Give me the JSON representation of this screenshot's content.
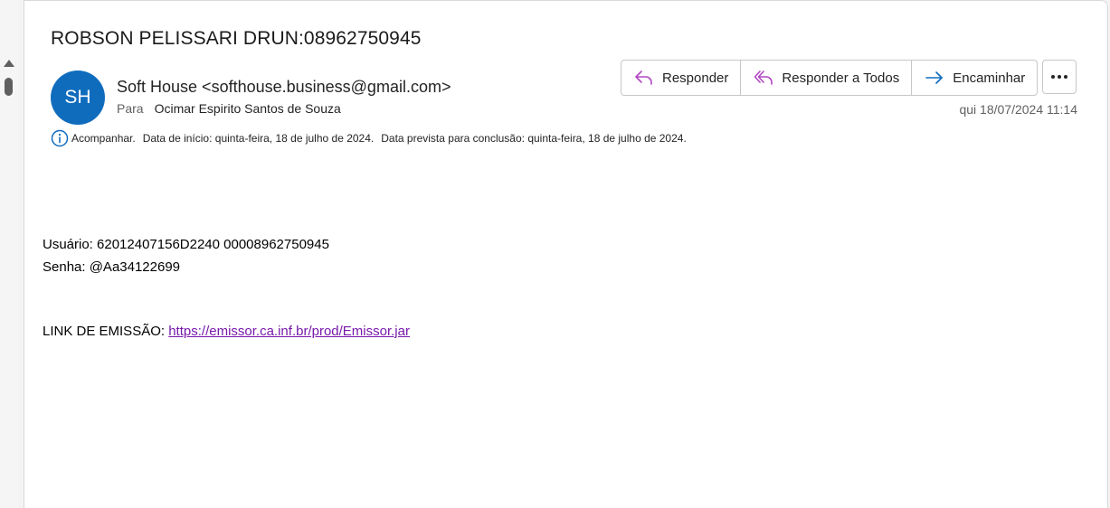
{
  "email": {
    "subject": "ROBSON PELISSARI DRUN:08962750945",
    "avatar_initials": "SH",
    "avatar_color": "#0f6cbd",
    "sender": "Soft House <softhouse.business@gmail.com>",
    "to_label": "Para",
    "to_name": "Ocimar Espirito Santos de Souza",
    "date": "qui 18/07/2024 11:14",
    "followup": {
      "icon": "info-icon",
      "flag": "Acompanhar.",
      "start": "Data de início: quinta-feira, 18 de julho de 2024.",
      "due": "Data prevista para conclusão: quinta-feira, 18 de julho de 2024."
    },
    "body": {
      "usuario_line": "Usuário: 62012407156D2240 00008962750945",
      "senha_line": "Senha: @Aa34122699",
      "link_label": "LINK DE EMISSÃO: ",
      "link_url": "https://emissor.ca.inf.br/prod/Emissor.jar",
      "link_color": "#7719aa"
    }
  },
  "actions": {
    "reply": {
      "label": "Responder",
      "icon": "reply-icon"
    },
    "reply_all": {
      "label": "Responder a Todos",
      "icon": "reply-all-icon"
    },
    "forward": {
      "label": "Encaminhar",
      "icon": "forward-icon"
    },
    "more": {
      "icon": "more-icon"
    },
    "reply_icon_color": "#b146c2",
    "forward_icon_color": "#0f6cbd"
  }
}
